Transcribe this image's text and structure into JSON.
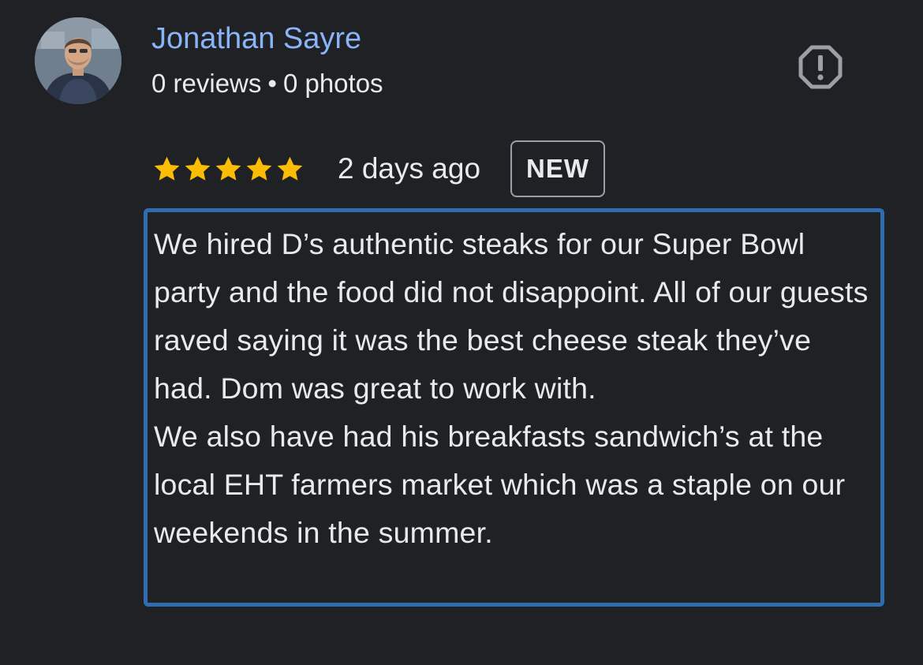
{
  "author": {
    "name": "Jonathan Sayre",
    "reviews": "0 reviews",
    "separator": "•",
    "photos": "0 photos"
  },
  "report_icon": "report-flag-icon",
  "rating": {
    "stars": 5,
    "max_stars": 5,
    "star_icon": "star-icon",
    "star_color": "#fbbc04",
    "time_ago": "2 days ago",
    "badge": "NEW"
  },
  "review": {
    "paragraph_1": "We hired D’s authentic steaks for our Super Bowl party and the food did not disappoint. All of our guests raved saying it was the best cheese steak they’ve had. Dom was great to work with.",
    "paragraph_2": "We also have had his breakfasts sandwich’s at the local EHT farmers market which was a staple on our weekends in the summer.",
    "highlight_color": "#2f6db0"
  },
  "colors": {
    "background": "#202124",
    "author_name": "#8ab4f8",
    "text": "#e8eaed",
    "icon_gray": "#9aa0a6"
  }
}
